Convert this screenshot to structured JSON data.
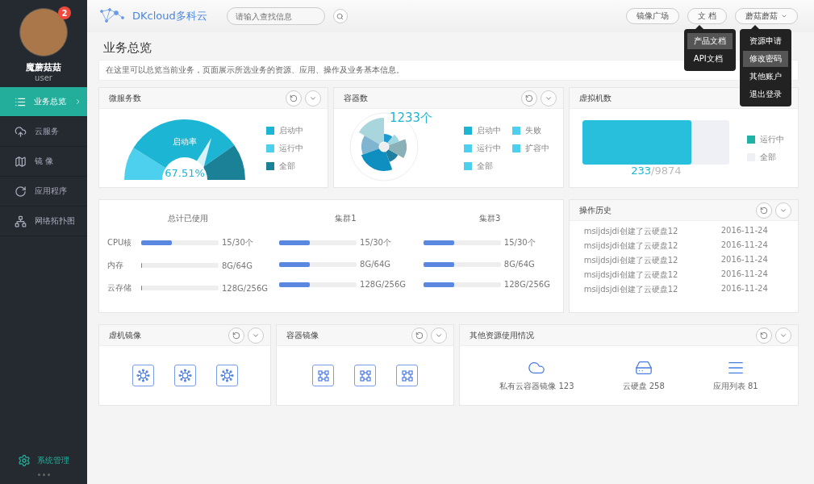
{
  "user": {
    "name": "魔蘑菇菇",
    "role": "user",
    "badge": "2"
  },
  "sidebar": {
    "items": [
      {
        "label": "业务总览",
        "selected": true
      },
      {
        "label": "云服务",
        "selected": false
      },
      {
        "label": "镜 像",
        "selected": false
      },
      {
        "label": "应用程序",
        "selected": false
      },
      {
        "label": "网络拓扑图",
        "selected": false
      }
    ],
    "footer": "系统管理"
  },
  "header": {
    "brand": "DKcloud多科云",
    "search": {
      "placeholder": "请输入查找信息"
    },
    "buttons": [
      "镜像广场",
      "文 档",
      "蘑菇蘑菇"
    ],
    "docs_menu": [
      {
        "label": "产品文档",
        "selected": true
      },
      {
        "label": "API文档",
        "selected": false
      }
    ],
    "user_menu": [
      {
        "label": "资源申请",
        "selected": false
      },
      {
        "label": "修改密码",
        "selected": true
      },
      {
        "label": "其他账户",
        "selected": false
      },
      {
        "label": "退出登录",
        "selected": false
      }
    ]
  },
  "page": {
    "title": "业务总览",
    "description": "在这里可以总览当前业务，页面展示所选业务的资源、应用、操作及业务基本信息。"
  },
  "microservices": {
    "title": "微服务数",
    "gauge_label": "启动率",
    "value": "67.51%",
    "legend": [
      {
        "label": "启动中",
        "color": "#1cb5d4"
      },
      {
        "label": "运行中",
        "color": "#4dd0ee"
      },
      {
        "label": "全部",
        "color": "#1a8197"
      }
    ]
  },
  "containers": {
    "title": "容器数",
    "total": "1233个",
    "legend": [
      {
        "label": "启动中",
        "color": "#1cb5d4"
      },
      {
        "label": "失败",
        "color": "#4dcfee"
      },
      {
        "label": "运行中",
        "color": "#4dcfee"
      },
      {
        "label": "扩容中",
        "color": "#4dcfee"
      },
      {
        "label": "全部",
        "color": "#4dcfee"
      }
    ]
  },
  "vms": {
    "title": "虚拟机数",
    "used": "233",
    "total": "/9874",
    "level": 0.74,
    "legend": [
      {
        "label": "运行中",
        "color": "#20b2a6"
      },
      {
        "label": "全部",
        "color": "#eef0f6"
      }
    ]
  },
  "usage": {
    "groups": [
      {
        "title": "总计已使用",
        "rows": [
          {
            "label": "CPU核",
            "level": 0.4,
            "reading": "15/30个"
          },
          {
            "label": "内存",
            "level": 0,
            "reading": "8G/64G"
          },
          {
            "label": "云存储",
            "level": 0,
            "reading": "128G/256G"
          }
        ]
      },
      {
        "title": "集群1",
        "rows": [
          {
            "level": 0.4,
            "reading": "15/30个"
          },
          {
            "level": 0.4,
            "reading": "8G/64G"
          },
          {
            "level": 0.4,
            "reading": "128G/256G"
          }
        ]
      },
      {
        "title": "集群3",
        "rows": [
          {
            "level": 0.4,
            "reading": "15/30个"
          },
          {
            "level": 0.4,
            "reading": "8G/64G"
          },
          {
            "level": 0.4,
            "reading": "128G/256G"
          }
        ]
      }
    ]
  },
  "history": {
    "title": "操作历史",
    "rows": [
      {
        "text": "msijdsjdi创建了云硬盘12",
        "date": "2016-11-24"
      },
      {
        "text": "msijdsjdi创建了云硬盘12",
        "date": "2016-11-24"
      },
      {
        "text": "msijdsjdi创建了云硬盘12",
        "date": "2016-11-24"
      },
      {
        "text": "msijdsjdi创建了云硬盘12",
        "date": "2016-11-24"
      },
      {
        "text": "msijdsjdi创建了云硬盘12",
        "date": "2016-11-24"
      }
    ]
  },
  "vm_images": {
    "title": "虚机镜像"
  },
  "container_images": {
    "title": "容器镜像"
  },
  "other_resources": {
    "title": "其他资源使用情况",
    "items": [
      {
        "label": "私有云容器镜像 123"
      },
      {
        "label": "云硬盘 258"
      },
      {
        "label": "应用列表 81"
      }
    ]
  }
}
